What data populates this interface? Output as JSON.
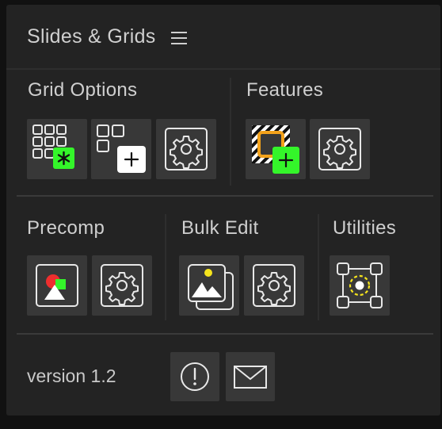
{
  "app": {
    "title": "Slides & Grids",
    "menu_icon": "hamburger-menu-icon"
  },
  "sections": {
    "grid_options": {
      "title": "Grid Options",
      "buttons": [
        "grid-new-icon",
        "grid-add-icon",
        "grid-settings-gear-icon"
      ]
    },
    "features": {
      "title": "Features",
      "buttons": [
        "feature-add-icon",
        "features-settings-gear-icon"
      ]
    },
    "precomp": {
      "title": "Precomp",
      "buttons": [
        "precomp-shapes-icon",
        "precomp-settings-gear-icon"
      ]
    },
    "bulk_edit": {
      "title": "Bulk Edit",
      "buttons": [
        "bulk-images-icon",
        "bulk-settings-gear-icon"
      ]
    },
    "utilities": {
      "title": "Utilities",
      "buttons": [
        "anchor-point-icon"
      ]
    }
  },
  "footer": {
    "version": "version 1.2",
    "buttons": [
      "info-icon",
      "mail-icon"
    ]
  },
  "colors": {
    "panel_bg": "#232323",
    "button_bg": "#383838",
    "accent_green": "#34f52a",
    "accent_orange": "#f3a21b",
    "accent_yellow": "#f5e41d",
    "accent_red": "#ee2e2e"
  }
}
